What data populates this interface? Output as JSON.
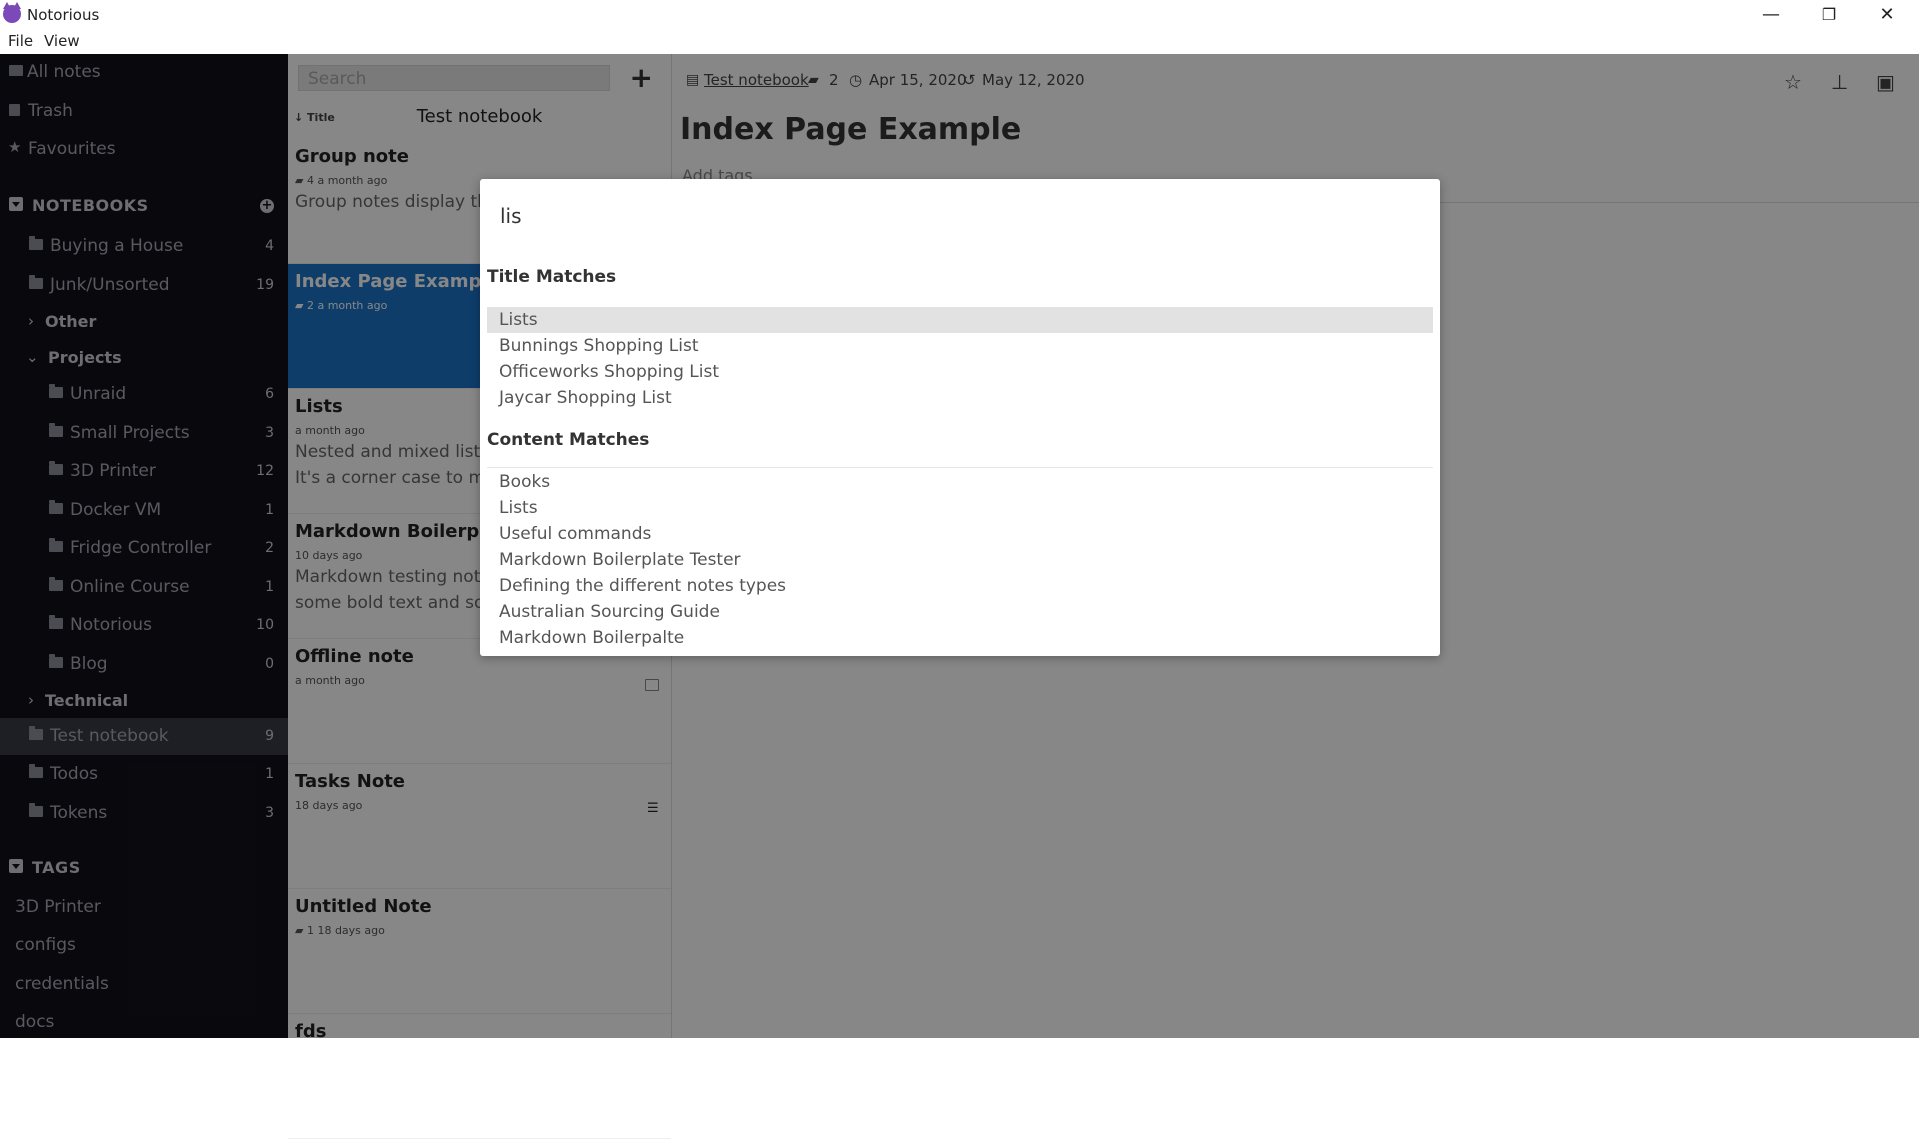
{
  "window": {
    "title": "Notorious",
    "minimize": "—",
    "maximize": "❐",
    "close": "✕"
  },
  "menu": [
    "File",
    "View"
  ],
  "sidebar": {
    "all_notes": "All notes",
    "trash": "Trash",
    "favourites": "Favourites",
    "notebooks_heading": "NOTEBOOKS",
    "notebooks": [
      {
        "label": "Buying a House",
        "count": "4"
      },
      {
        "label": "Junk/Unsorted",
        "count": "19"
      },
      {
        "label": "Other",
        "count": ""
      },
      {
        "label": "Projects",
        "count": ""
      },
      {
        "label": "Unraid",
        "count": "6"
      },
      {
        "label": "Small Projects",
        "count": "3"
      },
      {
        "label": "3D Printer",
        "count": "12"
      },
      {
        "label": "Docker VM",
        "count": "1"
      },
      {
        "label": "Fridge Controller",
        "count": "2"
      },
      {
        "label": "Online Course",
        "count": "1"
      },
      {
        "label": "Notorious",
        "count": "10"
      },
      {
        "label": "Blog",
        "count": "0"
      },
      {
        "label": "Technical",
        "count": ""
      },
      {
        "label": "Test notebook",
        "count": "9"
      },
      {
        "label": "Todos",
        "count": "1"
      },
      {
        "label": "Tokens",
        "count": "3"
      }
    ],
    "tags_heading": "TAGS",
    "tags": [
      "3D Printer",
      "configs",
      "credentials",
      "docs"
    ]
  },
  "notelist": {
    "search_placeholder": "Search",
    "add": "+",
    "sort_label": "↓ Title",
    "notebook_name": "Test notebook",
    "notes": [
      {
        "title": "Group note",
        "meta": "▰ 4 a month ago",
        "preview": [
          "Group notes display the"
        ]
      },
      {
        "title": "Index Page Example",
        "meta": "▰ 2 a month ago",
        "preview": []
      },
      {
        "title": "Lists",
        "meta": "a month ago",
        "preview": [
          "Nested and mixed lists a",
          "It's a corner case to mak"
        ]
      },
      {
        "title": "Markdown Boilerpalte",
        "meta": "10 days ago",
        "preview": [
          "Markdown testing note.",
          "some bold text and som"
        ]
      },
      {
        "title": "Offline note",
        "meta": "a month ago",
        "preview": []
      },
      {
        "title": "Tasks Note",
        "meta": "18 days ago",
        "preview": []
      },
      {
        "title": "Untitled Note",
        "meta": "▰ 1 18 days ago",
        "preview": []
      },
      {
        "title": "fds",
        "meta": "",
        "preview": []
      }
    ]
  },
  "editor": {
    "notebook": "Test notebook",
    "group_count": "2",
    "created": "Apr 15, 2020",
    "modified": "May 12, 2020",
    "title": "Index Page Example",
    "tags_placeholder": "Add tags"
  },
  "search_modal": {
    "query": "lis",
    "title_heading": "Title Matches",
    "title_matches": [
      "Lists",
      "Bunnings Shopping List",
      "Officeworks Shopping List",
      "Jaycar Shopping List"
    ],
    "content_heading": "Content Matches",
    "content_matches": [
      "Books",
      "Lists",
      "Useful commands",
      "Markdown Boilerplate Tester",
      "Defining the different notes types",
      "Australian Sourcing Guide",
      "Markdown Boilerpalte"
    ]
  }
}
